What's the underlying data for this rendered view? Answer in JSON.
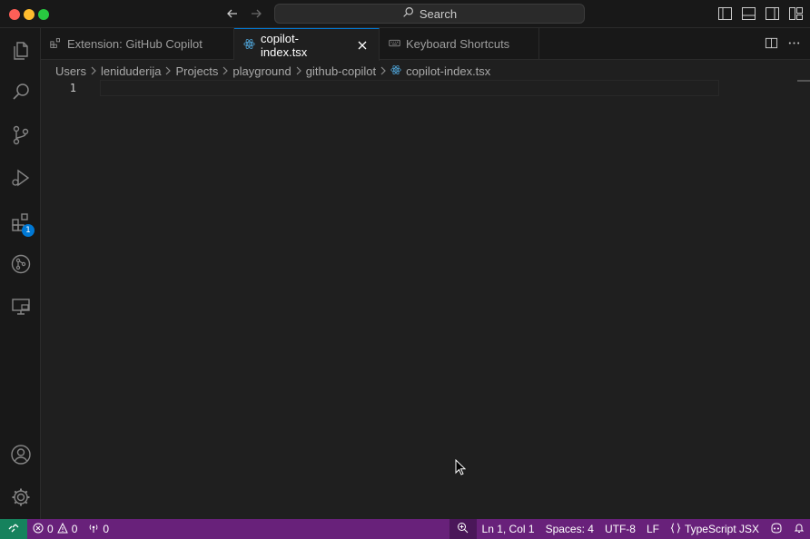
{
  "titlebar": {
    "search_label": "Search"
  },
  "activity": {
    "extensions_badge": "1"
  },
  "tabs": [
    {
      "label": "Extension: GitHub Copilot",
      "icon": "extension-icon",
      "active": false
    },
    {
      "label": "copilot-index.tsx",
      "icon": "react-icon",
      "active": true
    },
    {
      "label": "Keyboard Shortcuts",
      "icon": "keyboard-icon",
      "active": false
    }
  ],
  "breadcrumb": [
    "Users",
    "leniduderija",
    "Projects",
    "playground",
    "github-copilot",
    "copilot-index.tsx"
  ],
  "editor": {
    "line_numbers": [
      "1"
    ]
  },
  "statusbar": {
    "errors": "0",
    "warnings": "0",
    "ports": "0",
    "position": "Ln 1, Col 1",
    "spaces": "Spaces: 4",
    "encoding": "UTF-8",
    "eol": "LF",
    "language": "TypeScript JSX"
  },
  "colors": {
    "statusbar_bg": "#68217a",
    "remote_bg": "#16825d",
    "accent": "#0078d4",
    "react_icon": "#4ea1d3"
  }
}
